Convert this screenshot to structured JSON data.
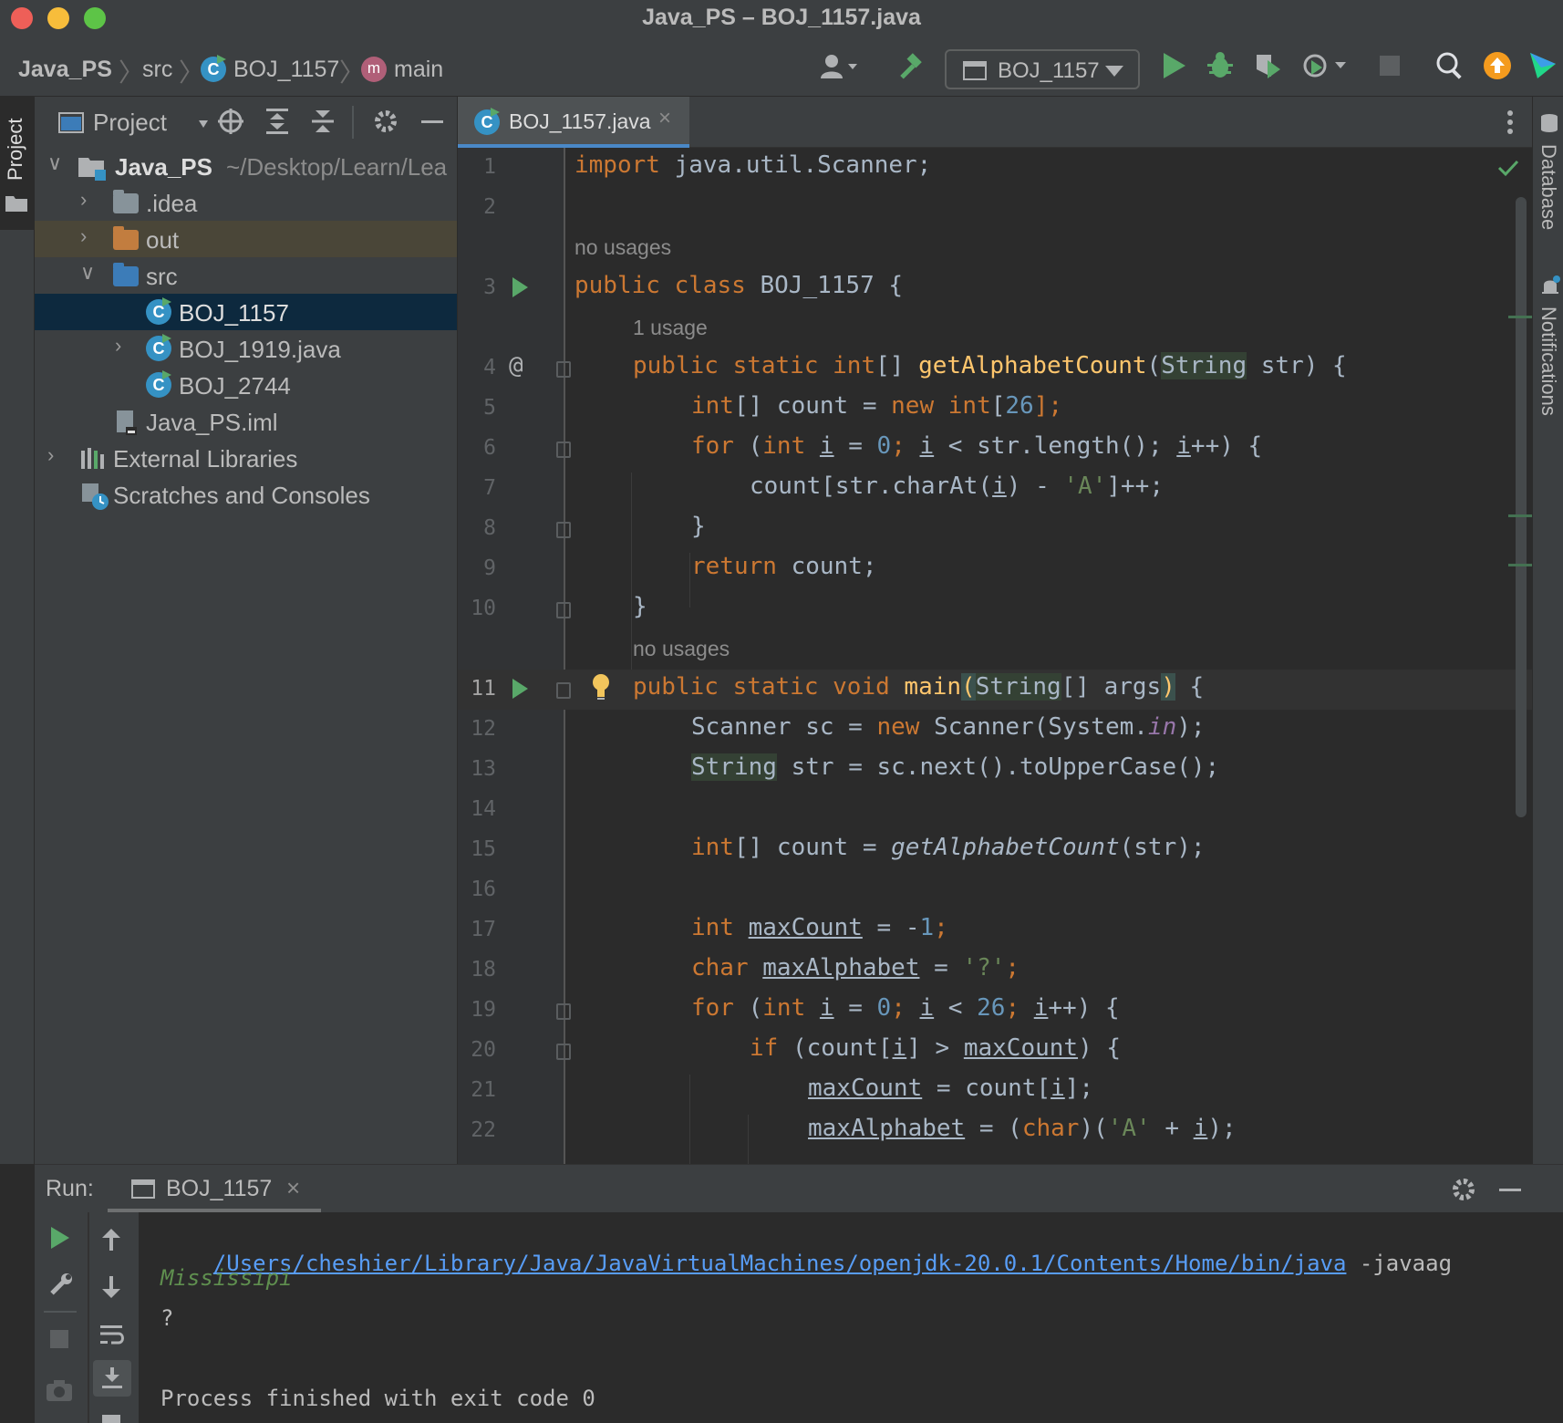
{
  "window": {
    "title": "Java_PS – BOJ_1157.java",
    "traffic_colors": [
      "#ee5f58",
      "#f7bd3b",
      "#5dc447"
    ]
  },
  "navbar": {
    "breadcrumbs": [
      "Java_PS",
      "src",
      "BOJ_1157",
      "main"
    ],
    "run_config": "BOJ_1157",
    "icons": [
      "user-icon",
      "hammer-icon",
      "run-icon",
      "debug-icon",
      "coverage-icon",
      "profile-icon",
      "stop-icon",
      "search-icon",
      "update-icon",
      "logo-icon"
    ]
  },
  "left_strip": {
    "tab_label": "Project"
  },
  "project": {
    "title": "Project",
    "tree": [
      {
        "label": "Java_PS",
        "path": "~/Desktop/Learn/Lea"
      },
      {
        "label": ".idea"
      },
      {
        "label": "out"
      },
      {
        "label": "src"
      },
      {
        "label": "BOJ_1157"
      },
      {
        "label": "BOJ_1919.java"
      },
      {
        "label": "BOJ_2744"
      },
      {
        "label": "Java_PS.iml"
      },
      {
        "label": "External Libraries"
      },
      {
        "label": "Scratches and Consoles"
      }
    ]
  },
  "editor": {
    "tab_label": "BOJ_1157.java",
    "hints": {
      "no_usages_1": "no usages",
      "one_usage": "1 usage",
      "no_usages_2": "no usages"
    },
    "line_numbers": [
      "1",
      "2",
      "3",
      "4",
      "5",
      "6",
      "7",
      "8",
      "9",
      "10",
      "11",
      "12",
      "13",
      "14",
      "15",
      "16",
      "17",
      "18",
      "19",
      "20",
      "21",
      "22"
    ],
    "code": {
      "l1_import": "import",
      "l1_rest": " java.util.Scanner;",
      "l3_public": "public class",
      "l3_rest": " BOJ_1157 {",
      "l4_mods": "public static int",
      "l4_brackets": "[] ",
      "l4_fn": "getAlphabetCount",
      "l4_open": "(",
      "l4_type": "String",
      "l4_rest": " str) {",
      "l5_type": "int",
      "l5_mid": "[] count = ",
      "l5_new": "new int",
      "l5_open": "[",
      "l5_num": "26",
      "l5_end": "];",
      "l6_for": "for",
      "l6_a": " (",
      "l6_int": "int",
      "l6_sp": " ",
      "l6_i1": "i",
      "l6_b": " = ",
      "l6_zero": "0",
      "l6_semi": "; ",
      "l6_i2": "i",
      "l6_c": " < str.length(); ",
      "l6_i3": "i",
      "l6_d": "++) {",
      "l7_a": "count[str.charAt(",
      "l7_i": "i",
      "l7_b": ") - ",
      "l7_str": "'A'",
      "l7_c": "]++;",
      "l8": "}",
      "l9_ret": "return",
      "l9_rest": " count;",
      "l10": "}",
      "l11_mods": "public static void",
      "l11_sp": " ",
      "l11_fn": "main",
      "l11_paren": "(",
      "l11_type": "String",
      "l11_rest": "[] args",
      "l11_close": ")",
      "l11_end": " {",
      "l12_a": "Scanner sc = ",
      "l12_new": "new",
      "l12_b": " Scanner(System.",
      "l12_in": "in",
      "l12_c": ");",
      "l13_type": "String",
      "l13_rest": " str = sc.next().toUpperCase();",
      "l15_type": "int",
      "l15_a": "[] count = ",
      "l15_fn": "getAlphabetCount",
      "l15_b": "(str);",
      "l17_int": "int",
      "l17_sp": " ",
      "l17_var": "maxCount",
      "l17_a": " = -",
      "l17_num": "1",
      "l17_b": ";",
      "l18_char": "char",
      "l18_sp": " ",
      "l18_var": "maxAlphabet",
      "l18_a": " = ",
      "l18_str": "'?'",
      "l18_b": ";",
      "l19_for": "for",
      "l19_a": " (",
      "l19_int": "int",
      "l19_sp": " ",
      "l19_i1": "i",
      "l19_b": " = ",
      "l19_zero": "0",
      "l19_semi": "; ",
      "l19_i2": "i",
      "l19_c": " < ",
      "l19_num": "26",
      "l19_semi2": "; ",
      "l19_i3": "i",
      "l19_d": "++) {",
      "l20_if": "if",
      "l20_a": " (count[",
      "l20_i": "i",
      "l20_b": "] > ",
      "l20_var": "maxCount",
      "l20_c": ") {",
      "l21_var": "maxCount",
      "l21_a": " = count[",
      "l21_i": "i",
      "l21_b": "];",
      "l22_var": "maxAlphabet",
      "l22_a": " = (",
      "l22_char": "char",
      "l22_b": ")(",
      "l22_str": "'A'",
      "l22_c": " + ",
      "l22_i": "i",
      "l22_d": ");"
    }
  },
  "right_strip": {
    "tabs": [
      "Database",
      "Notifications"
    ]
  },
  "run_panel": {
    "label": "Run:",
    "tab_label": "BOJ_1157",
    "output": {
      "java_path": "/Users/cheshier/Library/Java/JavaVirtualMachines/openjdk-20.0.1/Contents/Home/bin/java",
      "java_args": " -javaag",
      "input": "Mississipi",
      "result": "?",
      "finished": "Process finished with exit code 0"
    }
  }
}
